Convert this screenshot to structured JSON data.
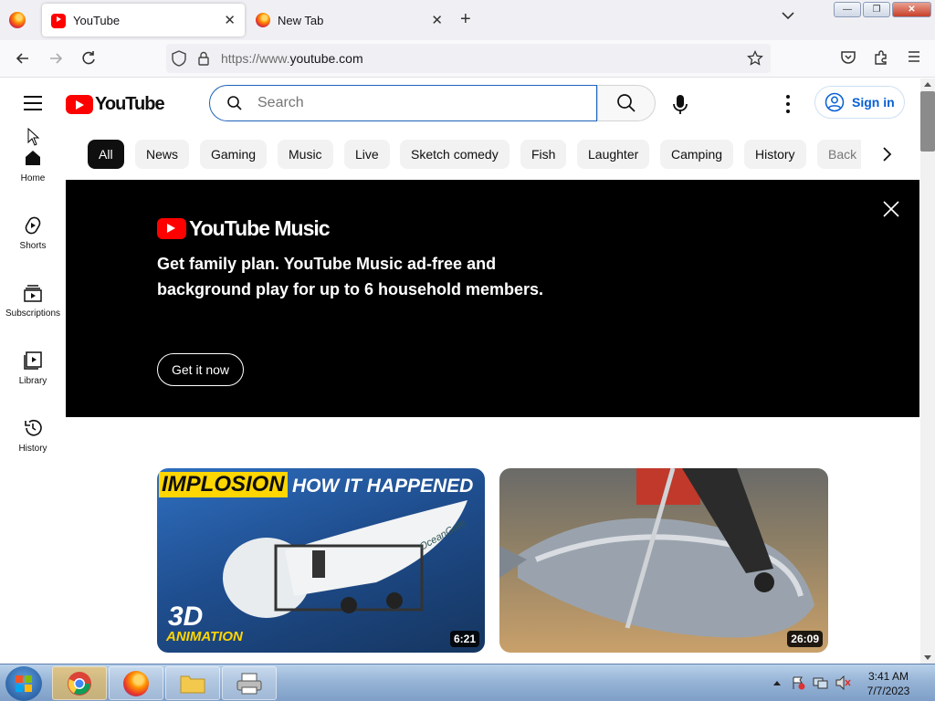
{
  "browser": {
    "tabs": [
      {
        "title": "YouTube",
        "active": true,
        "icon": "youtube-favicon"
      },
      {
        "title": "New Tab",
        "active": false,
        "icon": "firefox-favicon"
      }
    ],
    "new_tab_glyph": "+",
    "url_prefix": "https://www.",
    "url_domain": "youtube.com",
    "close_glyph": "✕",
    "window_buttons": [
      "—",
      "❐",
      "✕"
    ]
  },
  "youtube": {
    "logo_text": "YouTube",
    "search_placeholder": "Search",
    "sign_in": "Sign in",
    "guide": [
      {
        "label": "Home",
        "icon": "home-icon"
      },
      {
        "label": "Shorts",
        "icon": "shorts-icon"
      },
      {
        "label": "Subscriptions",
        "icon": "subscriptions-icon"
      },
      {
        "label": "Library",
        "icon": "library-icon"
      },
      {
        "label": "History",
        "icon": "history-icon"
      }
    ],
    "chips": [
      "All",
      "News",
      "Gaming",
      "Music",
      "Live",
      "Sketch comedy",
      "Fish",
      "Laughter",
      "Camping",
      "History",
      "Back"
    ],
    "banner": {
      "brand": "YouTube Music",
      "message": "Get family plan. YouTube Music ad-free and background play for up to 6 household members.",
      "cta": "Get it now"
    },
    "videos": [
      {
        "thumb_text_1": "IMPLOSION",
        "thumb_text_2": "HOW IT HAPPENED",
        "thumb_text_3": "3D",
        "thumb_text_4": "ANIMATION",
        "thumb_text_5": "OceanGate",
        "duration": "6:21"
      },
      {
        "duration": "26:09"
      }
    ]
  },
  "taskbar": {
    "time": "3:41 AM",
    "date": "7/7/2023"
  },
  "colors": {
    "youtube_red": "#ff0000",
    "link_blue": "#065fd4",
    "banner_bg": "#000000"
  }
}
